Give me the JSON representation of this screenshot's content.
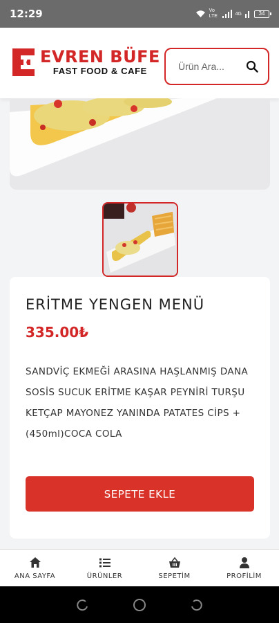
{
  "status_bar": {
    "time": "12:29",
    "network_label": "Vo LTE",
    "signal2_label": "4G",
    "battery": "34"
  },
  "brand": {
    "name": "EVREN BÜFE",
    "tagline": "FAST FOOD & CAFE",
    "color": "#d32626"
  },
  "search": {
    "placeholder": "Ürün Ara..."
  },
  "product": {
    "name": "ERİTME YENGEN MENÜ",
    "price": "335.00₺",
    "description": "SANDVİÇ EKMEĞİ ARASINA HAŞLANMIŞ DANA SOSİS SUCUK ERİTME KAŞAR PEYNİRİ TURŞU KETÇAP MAYONEZ YANINDA PATATES CİPS +(450ml)COCA COLA",
    "add_to_cart": "SEPETE EKLE"
  },
  "bottom_nav": {
    "items": [
      {
        "label": "ANA SAYFA",
        "icon": "home-icon"
      },
      {
        "label": "ÜRÜNLER",
        "icon": "list-icon"
      },
      {
        "label": "SEPETİM",
        "icon": "basket-icon"
      },
      {
        "label": "PROFİLİM",
        "icon": "user-icon"
      }
    ]
  },
  "system_nav": {
    "icons": [
      "recent-apps-icon",
      "home-circle-icon",
      "back-icon"
    ]
  }
}
